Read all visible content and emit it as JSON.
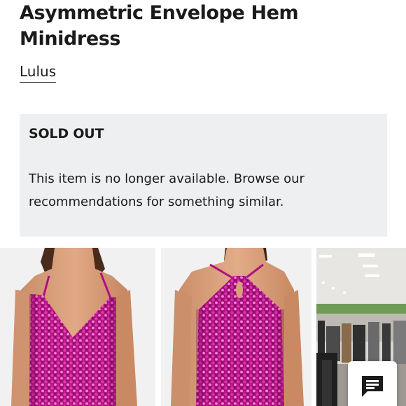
{
  "product": {
    "title": "Asymmetric Envelope Hem Minidress",
    "brand": "Lulus"
  },
  "availability": {
    "status": "SOLD OUT",
    "message": "This item is no longer available. Browse our recommendations for something similar."
  },
  "gallery": {
    "images": [
      {
        "icon": "dress-front-photo"
      },
      {
        "icon": "dress-back-photo"
      },
      {
        "icon": "store-interior-photo"
      }
    ]
  },
  "chat": {
    "icon": "chat-icon"
  },
  "colors": {
    "panel_background": "#eeeff0",
    "text": "#1b1b1b",
    "dress_pink": "#c0188a"
  }
}
